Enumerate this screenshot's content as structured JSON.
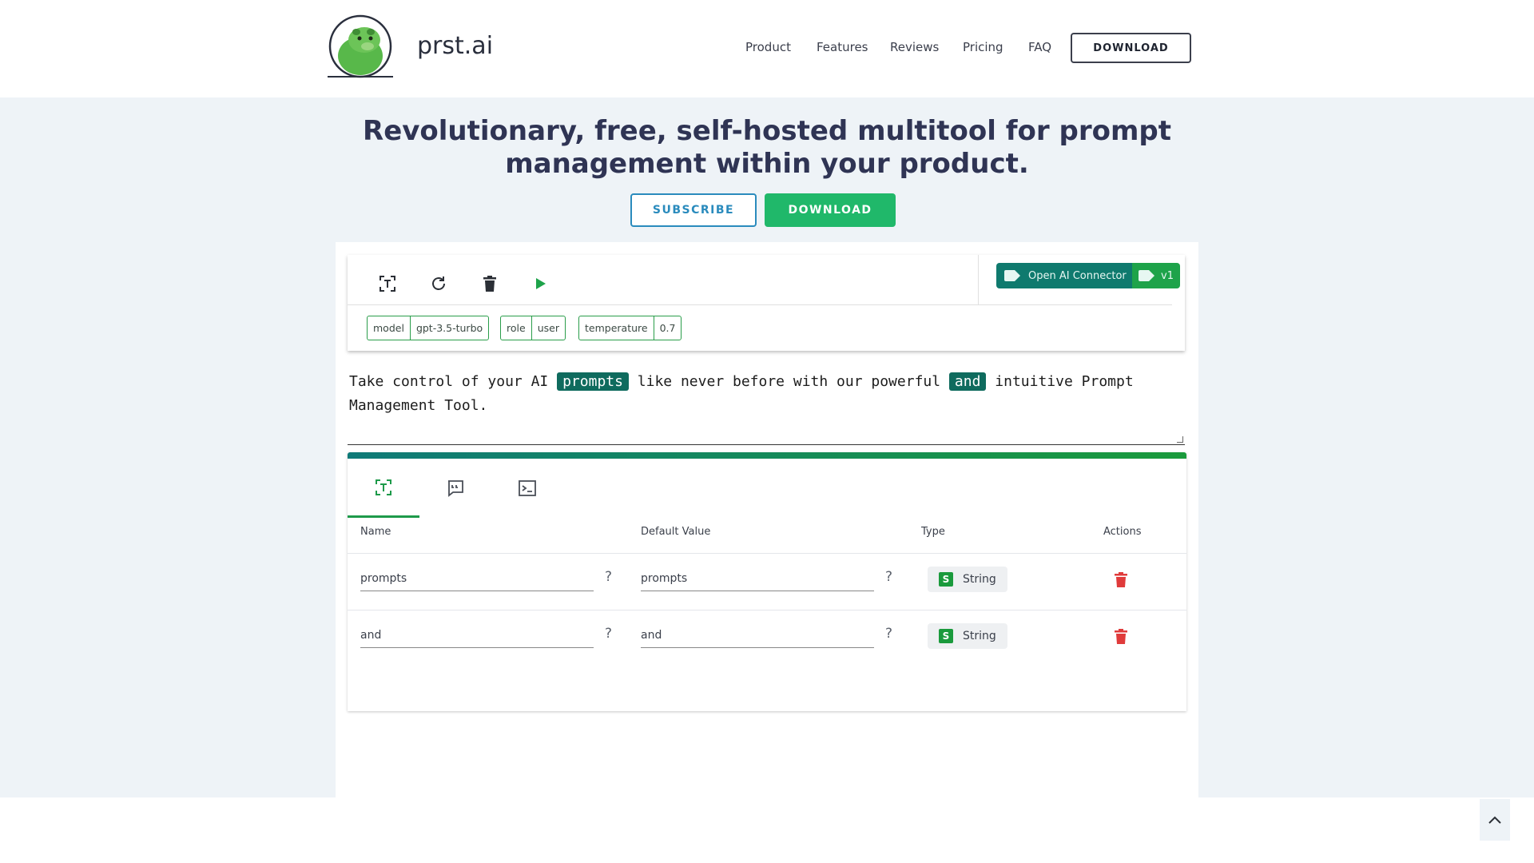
{
  "header": {
    "brand": "prst.ai",
    "nav": [
      "Product",
      "Features",
      "Reviews",
      "Pricing",
      "FAQ"
    ],
    "download_label": "DOWNLOAD"
  },
  "hero": {
    "headline": "Revolutionary, free, self-hosted multitool for prompt management within your product.",
    "subscribe_label": "SUBSCRIBE",
    "download_label": "DOWNLOAD"
  },
  "toolbar": {
    "icons": [
      "text-variable-icon",
      "refresh-icon",
      "trash-icon",
      "play-icon"
    ],
    "connector_label": "Open AI Connector",
    "version_label": "v1",
    "params": [
      {
        "key": "model",
        "value": "gpt-3.5-turbo"
      },
      {
        "key": "role",
        "value": "user"
      },
      {
        "key": "temperature",
        "value": "0.7"
      }
    ]
  },
  "prompt": {
    "text_1": "Take control of your AI ",
    "var_1": "prompts",
    "text_2": " like never before with our powerful ",
    "var_2": "and",
    "text_3": " intuitive Prompt Management Tool."
  },
  "variables": {
    "tabs": [
      "text-variable-icon",
      "quote-icon",
      "terminal-icon"
    ],
    "columns": {
      "name": "Name",
      "default": "Default Value",
      "type": "Type",
      "actions": "Actions"
    },
    "rows": [
      {
        "name": "prompts",
        "default": "prompts",
        "type": "String",
        "type_badge": "S"
      },
      {
        "name": "and",
        "default": "and",
        "type": "String",
        "type_badge": "S"
      }
    ],
    "help_mark": "?"
  },
  "colors": {
    "accent_green": "#20b86a",
    "variable_highlight": "#0f6b5e",
    "headline": "#2f3454",
    "delete_red": "#e03b3b"
  }
}
